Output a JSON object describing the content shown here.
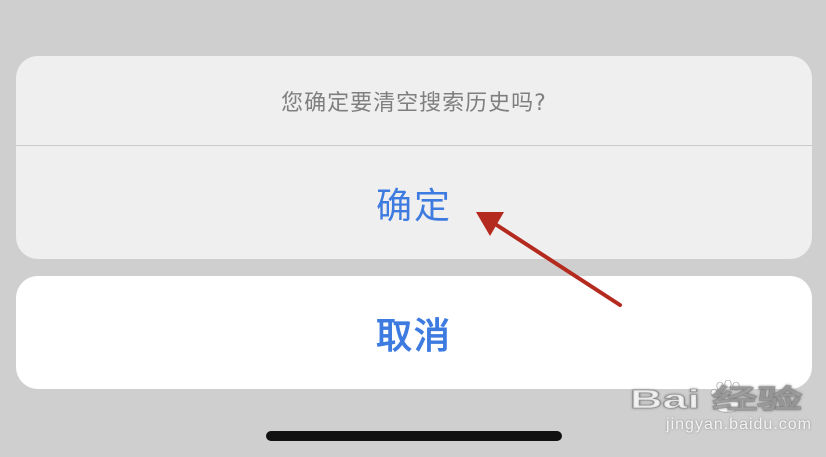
{
  "dialog": {
    "message": "您确定要清空搜索历史吗?",
    "confirm_label": "确定",
    "cancel_label": "取消"
  },
  "watermark": {
    "logo_text": "Bai 经验",
    "url": "jingyan.baidu.com"
  },
  "colors": {
    "background": "#cfcfcf",
    "sheet": "#efefef",
    "button_text": "#3d7be0",
    "arrow": "#b52a1e"
  },
  "icons": {
    "annotation_arrow": "red-arrow-icon",
    "watermark_paw": "paw-icon"
  }
}
